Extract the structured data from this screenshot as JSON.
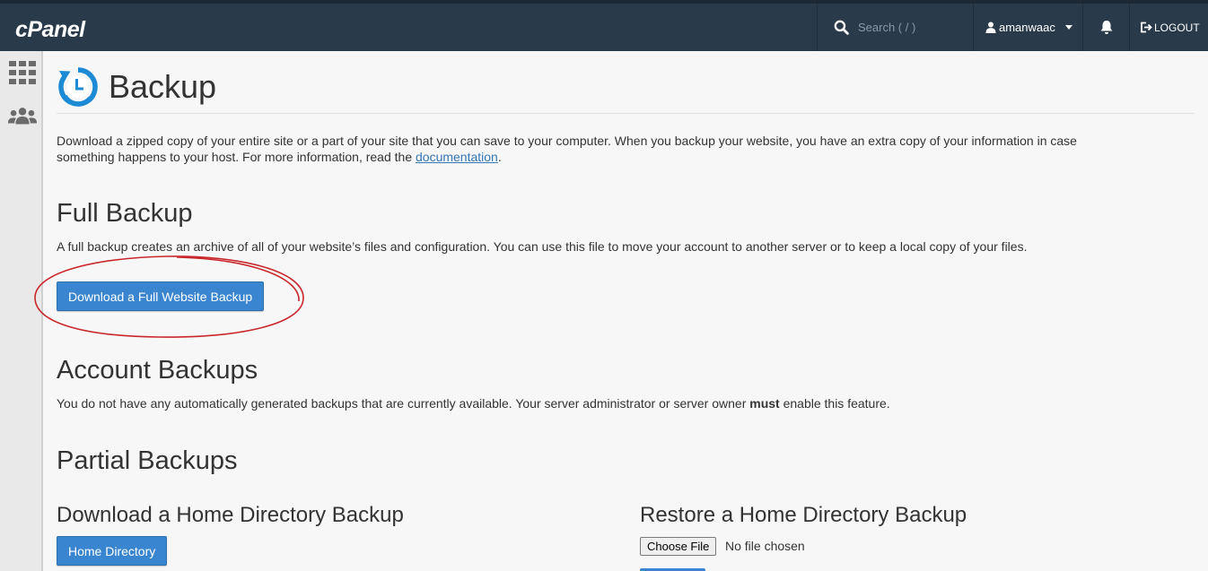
{
  "header": {
    "logo": "cPanel",
    "search_placeholder": "Search ( / )",
    "username": "amanwaac",
    "logout_label": "LOGOUT"
  },
  "page": {
    "title": "Backup",
    "intro_text": "Download a zipped copy of your entire site or a part of your site that you can save to your computer. When you backup your website, you have an extra copy of your information in case",
    "intro_text_2": "something happens to your host. For more information, read the",
    "intro_link": "documentation",
    "intro_end": "."
  },
  "full_backup": {
    "heading": "Full Backup",
    "description": "A full backup creates an archive of all of your website’s files and configuration. You can use this file to move your account to another server or to keep a local copy of your files.",
    "button_label": "Download a Full Website Backup"
  },
  "account_backups": {
    "heading": "Account Backups",
    "text_before": "You do not have any automatically generated backups that are currently available. Your server administrator or server owner ",
    "text_bold": "must",
    "text_after": " enable this feature."
  },
  "partial_backups": {
    "heading": "Partial Backups",
    "download_home": {
      "heading": "Download a Home Directory Backup",
      "button_label": "Home Directory"
    },
    "restore_home": {
      "heading": "Restore a Home Directory Backup",
      "choose_file_label": "Choose File",
      "no_file_text": "No file chosen"
    }
  },
  "colors": {
    "topbar": "#293a4a",
    "primary_button": "#3a85cf",
    "link": "#3277b8",
    "annotation_circle": "#c9272b",
    "backup_icon": "#1d8ad6"
  }
}
